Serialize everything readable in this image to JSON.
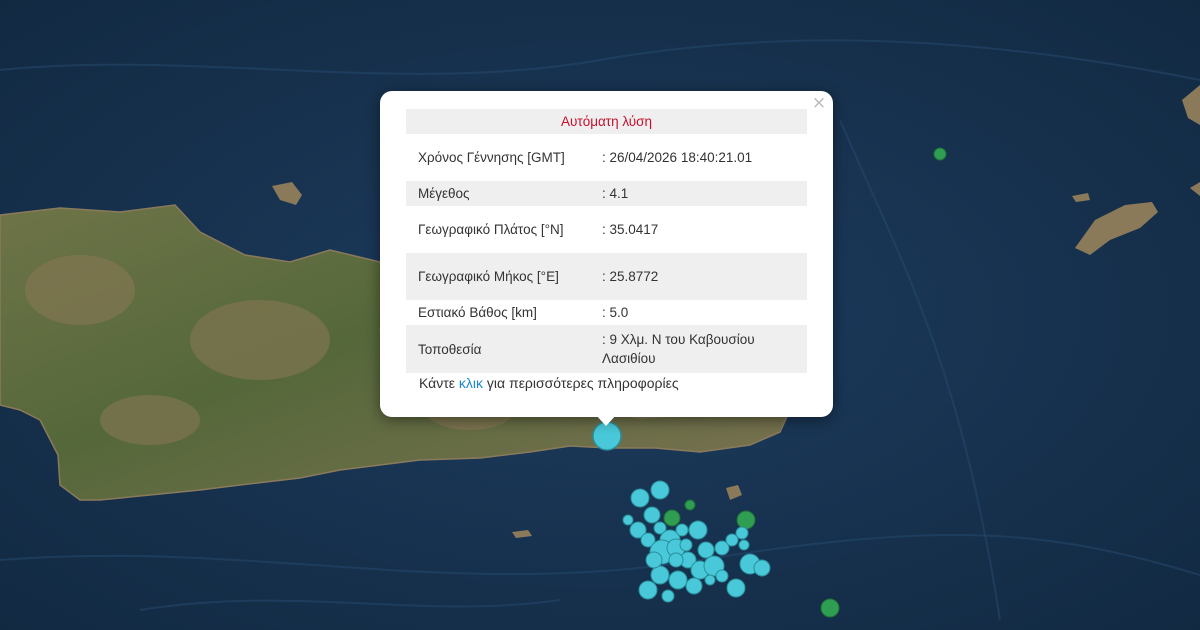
{
  "popup": {
    "title": "Αυτόματη λύση",
    "close_symbol": "×",
    "rows": [
      {
        "label": "Χρόνος Γέννησης [GMT]",
        "value": ": 26/04/2026 18:40:21.01"
      },
      {
        "label": "Μέγεθος",
        "value": ": 4.1"
      },
      {
        "label": "Γεωγραφικό Πλάτος [°N]",
        "value": ": 35.0417"
      },
      {
        "label": "Γεωγραφικό Μήκος [°E]",
        "value": ": 25.8772"
      },
      {
        "label": "Εστιακό Βάθος [km]",
        "value": ": 5.0"
      },
      {
        "label": "Τοποθεσία",
        "value": ": 9 Χλμ. Ν του Καβουσίου Λασιθίου"
      }
    ],
    "more_prefix": "Κάντε ",
    "more_link": "κλικ",
    "more_suffix": " για περισσότερες πληροφορίες"
  },
  "map": {
    "basemap": "satellite-imagery",
    "sea_color": "#1b3a5c",
    "land_color": "#5d6e3c",
    "selected_marker": "selected-earthquake-marker",
    "marker_colors": {
      "recent": "#48c8d8",
      "older": "#2f9e52",
      "marker_edge": "#2a8f9a"
    }
  }
}
